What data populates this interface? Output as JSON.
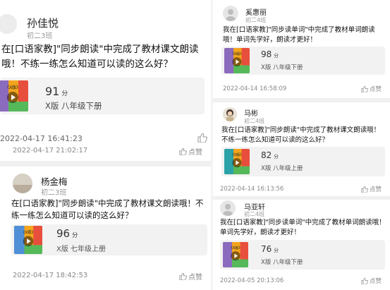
{
  "like_label": "点赞",
  "score_unit": "分",
  "thumb_label": "《X版》",
  "left_posts": [
    {
      "name": "孙佳悦",
      "class": "初二3班",
      "message": "在[口语家教]\"同步朗读\"中完成了教材课文朗读哦！不练一练怎么知道可以读的这么好？",
      "score": "91",
      "book": "X版 八年级下册",
      "first_time": "2022-04-17 16:41:23",
      "time": "2022-04-17 21:02:17"
    },
    {
      "name": "杨金梅",
      "class": "初二3班",
      "message": "在[口语家教]\"同步朗读\"中完成了教材课文朗读哦！不练一练怎么知道可以读的这么好？",
      "score": "96",
      "book": "X版 七年级上册",
      "time": "2022-04-17 18:42:53"
    }
  ],
  "right_posts": [
    {
      "name": "奚惠丽",
      "class": "初二4班",
      "message": "我在[口语家教]\"同步读单词\"中完成了教材单词朗读哦！单词先学好，朗读才更好！",
      "score": "98",
      "book": "X版 八年级下册",
      "time": "2022-04-14 16:58:09"
    },
    {
      "name": "马彬",
      "class": "初二4班",
      "message": "我在[口语家教]\"同步朗读\"中完成了教材课文朗读哦！不练一练怎么知道可以读的这么好？",
      "score": "82",
      "book": "X版 八年级上册",
      "time": "2022-04-14 16:13:56"
    },
    {
      "name": "马亚轩",
      "class": "初二4班",
      "message": "我在[口语家教]\"同步读单词\"中完成了教材单词朗读哦！单词先学好，朗读才更好！",
      "score": "76",
      "book": "X版 八年级下册",
      "time": "2022-04-05 20:13:06"
    }
  ]
}
